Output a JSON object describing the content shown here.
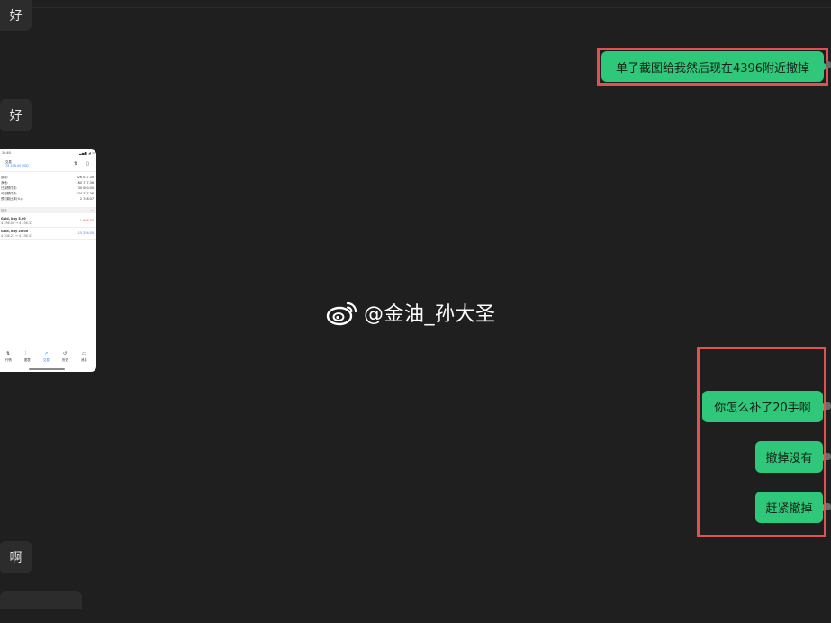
{
  "incoming": {
    "msg1": "好",
    "msg2": "好",
    "msg3": "啊"
  },
  "outgoing": {
    "msg1": "单子截图给我然后现在4396附近撤掉",
    "msg2": "你怎么补了20手啊",
    "msg3": "撤掉没有",
    "msg4": "赶紧撤掉"
  },
  "thumbnail": {
    "status_time": "10:40",
    "account_label": "交易",
    "account_value": "74 298.00 USD",
    "rows": [
      {
        "label": "余额:",
        "value": "326 027.30"
      },
      {
        "label": "净值:",
        "value": "160 717.36"
      },
      {
        "label": "已用预付款:",
        "value": "30 000.00"
      },
      {
        "label": "可用预付款:",
        "value": "274 717.36"
      },
      {
        "label": "预付款比率(%):",
        "value": "2 748.07"
      }
    ],
    "section": "持仓",
    "positions": [
      {
        "symbol": "Gold, buy 5.00",
        "price": "4 296.00 → 4 236.37",
        "pl": "-1 608.50",
        "pl_color": "#e05252"
      },
      {
        "symbol": "Gold, buy 20.00",
        "price": "4 308.27 → 4 236.37",
        "pl": "-15 356.00",
        "pl_color": "#3b82f6"
      }
    ],
    "nav": [
      "行情",
      "图表",
      "交易",
      "历史",
      "消息"
    ]
  },
  "watermark": {
    "text": "@金油_孙大圣",
    "icon": "weibo-icon"
  },
  "colors": {
    "background": "#1f1f1f",
    "incoming_bubble": "#2c2c2c",
    "outgoing_bubble": "#2fc77a",
    "highlight": "#e05252"
  }
}
